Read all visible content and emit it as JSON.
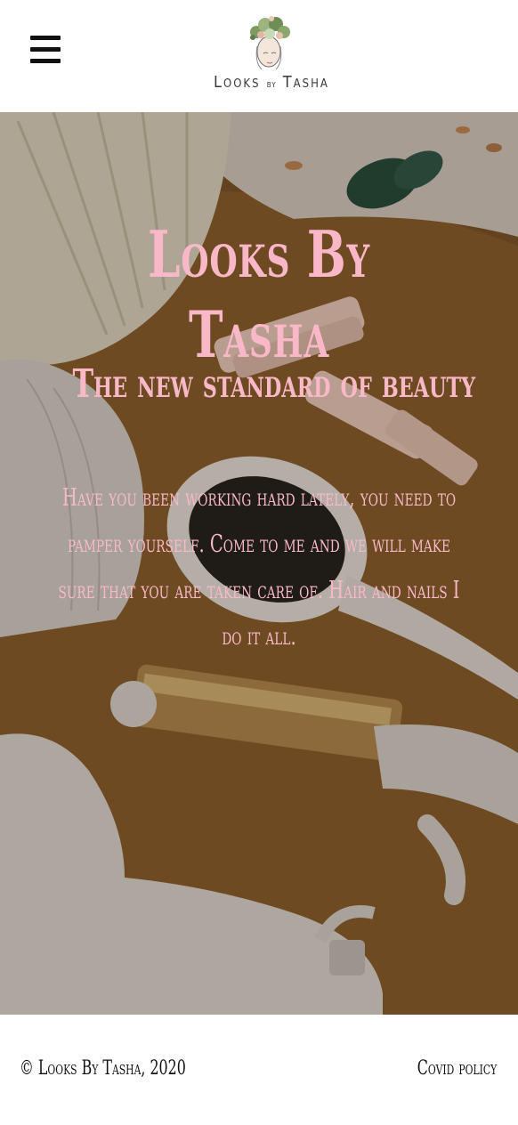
{
  "header": {
    "menu_icon": "hamburger-menu-icon",
    "logo": {
      "text_a": "Looks",
      "text_b": "by",
      "text_c": "Tasha"
    }
  },
  "hero": {
    "title": "Looks By Tasha",
    "subtitle": "The new standard of beauty",
    "body": "Have you been working hard lately, you need to pamper yourself. Come to me and we will make sure that you are taken care of. Hair and nails I do it all."
  },
  "footer": {
    "copyright": "© Looks By Tasha, 2020",
    "covid_link": "Covid policy"
  },
  "colors": {
    "accent_pink": "#f9b8c7",
    "text_dark": "#111111",
    "background": "#ffffff"
  }
}
